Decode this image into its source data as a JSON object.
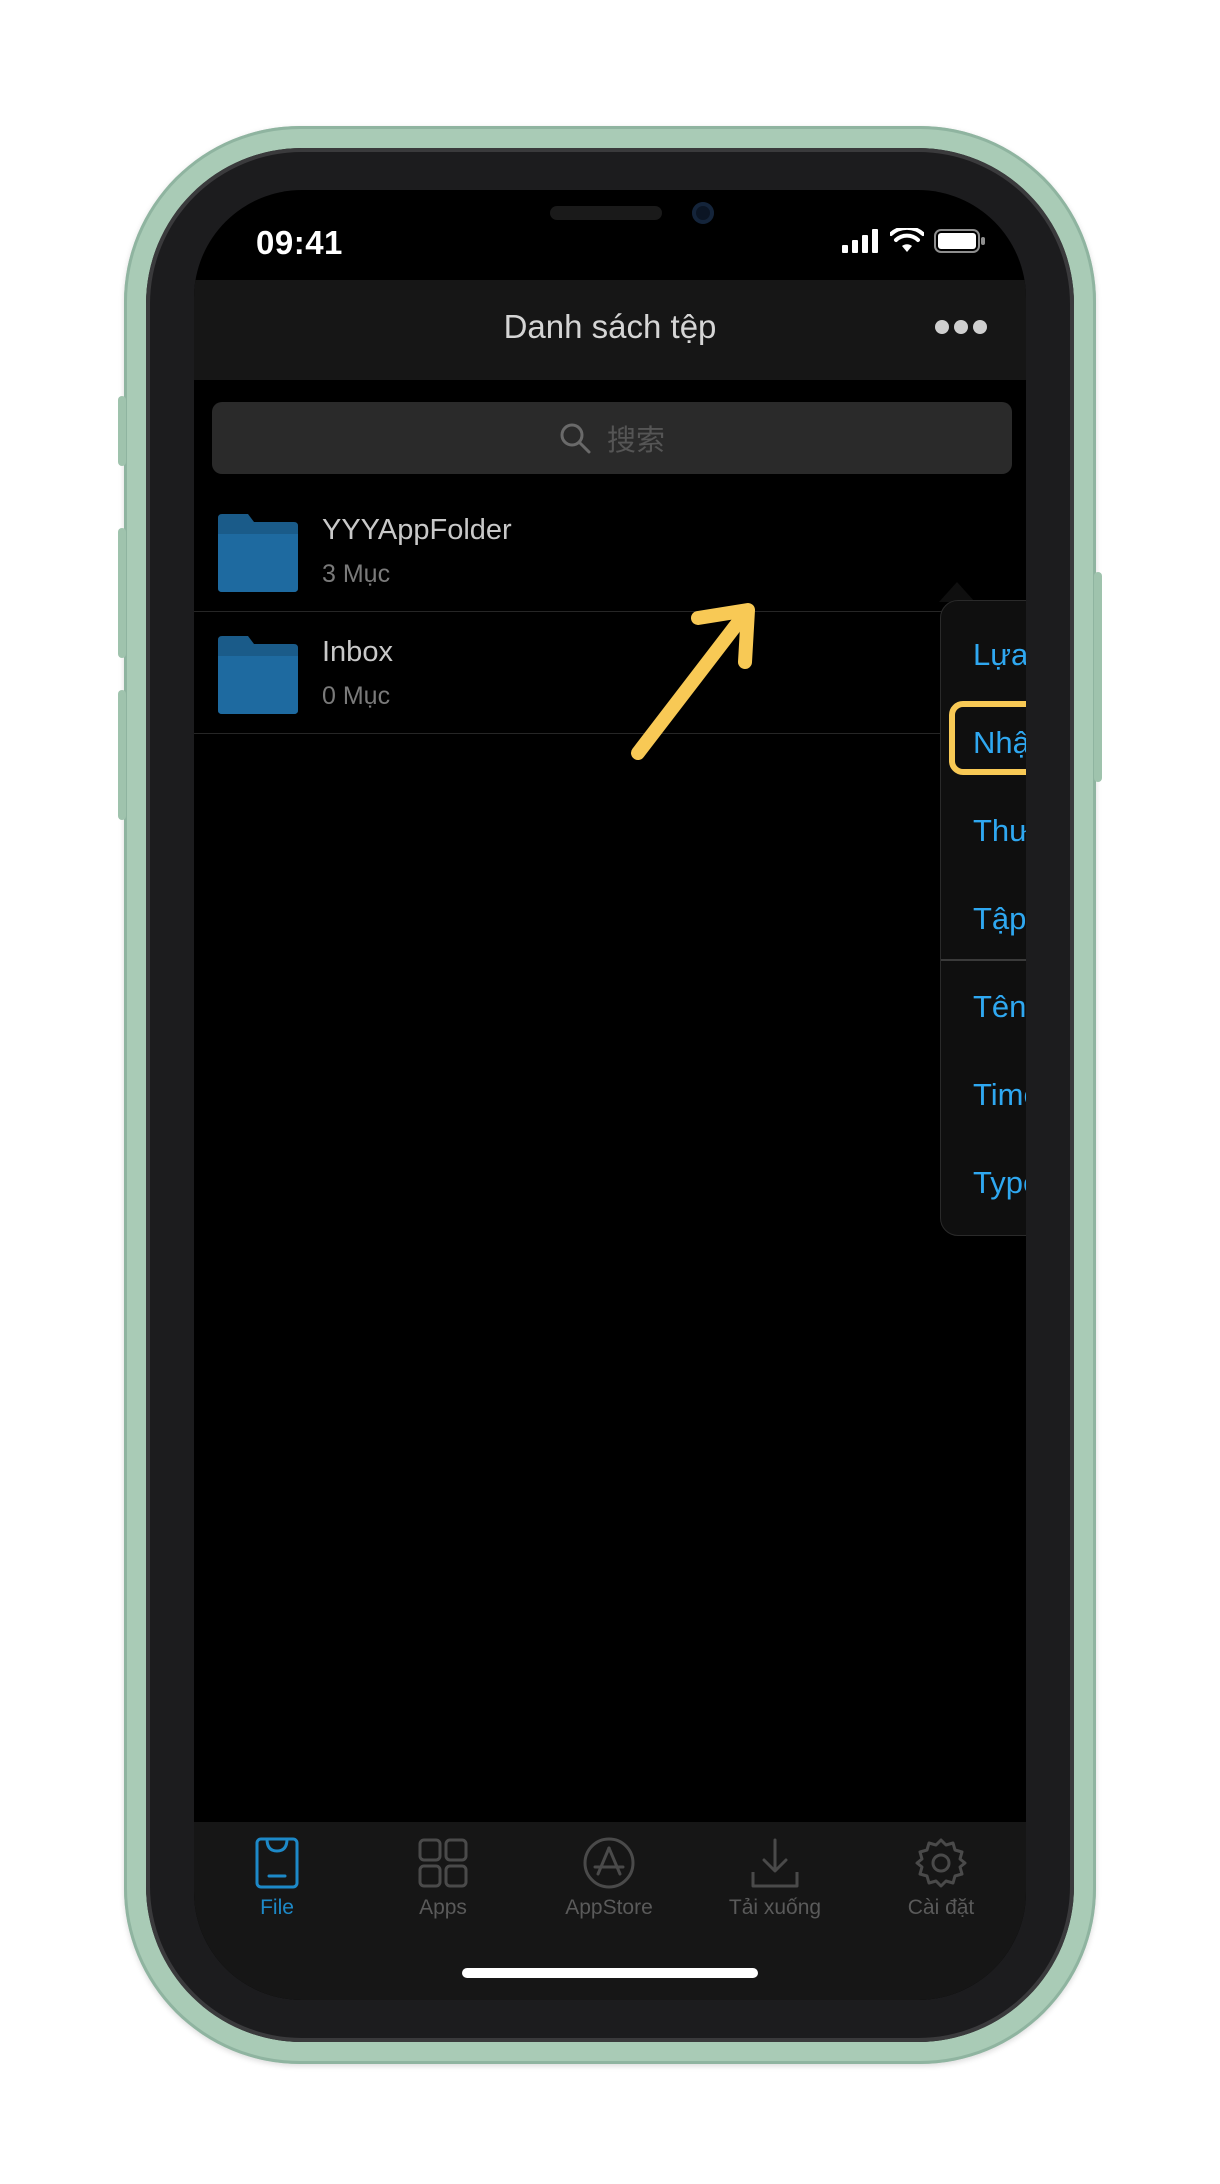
{
  "status_bar": {
    "time": "09:41"
  },
  "nav": {
    "title": "Danh sách tệp"
  },
  "search": {
    "placeholder": "搜索"
  },
  "files": [
    {
      "name": "YYYAppFolder",
      "count": "3 Mục"
    },
    {
      "name": "Inbox",
      "count": "0 Mục"
    }
  ],
  "menu": {
    "items": [
      "Lựa chọn",
      "Nhập",
      "Thư mục mới",
      "Tập tin mới"
    ],
    "sort_items": [
      "Tên",
      "Time",
      "Type"
    ],
    "highlighted": "Nhập"
  },
  "tabs": [
    {
      "label": "File",
      "icon": "file-tab-icon",
      "active": true
    },
    {
      "label": "Apps",
      "icon": "apps-grid-icon",
      "active": false
    },
    {
      "label": "AppStore",
      "icon": "appstore-icon",
      "active": false
    },
    {
      "label": "Tải xuống",
      "icon": "download-icon",
      "active": false
    },
    {
      "label": "Cài đặt",
      "icon": "settings-gear-icon",
      "active": false
    }
  ],
  "colors": {
    "accent_blue": "#2fa8f1",
    "tab_active": "#1d89c8",
    "annotation": "#f8c955",
    "folder": "#1c5f8f",
    "frame": "#a9cbb6"
  }
}
